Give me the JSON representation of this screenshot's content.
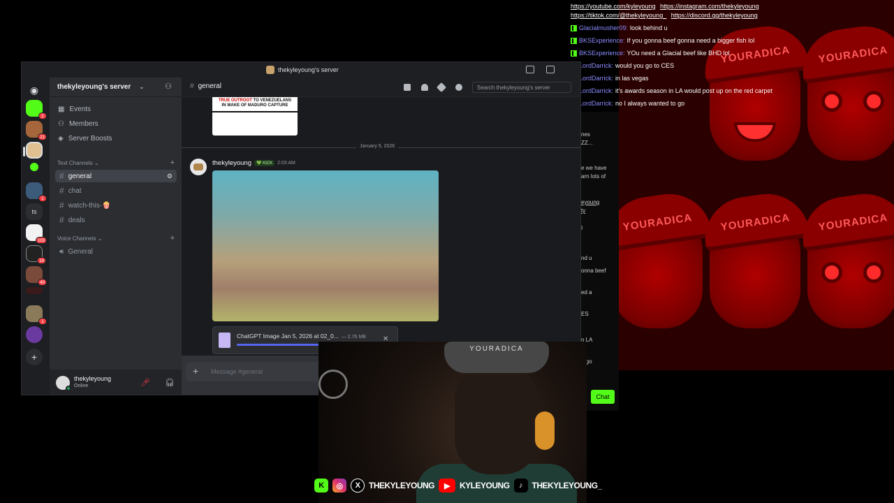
{
  "discord": {
    "window_title": "thekyleyoung's server",
    "server_name": "thekyleyoung's server",
    "nav": [
      "Events",
      "Members",
      "Server Boosts"
    ],
    "text_category": "Text Channels",
    "voice_category": "Voice Channels",
    "text_channels": [
      "general",
      "chat",
      "watch-this-🍿",
      "deals"
    ],
    "voice_channels": [
      "General"
    ],
    "server_badges": [
      "2",
      "21",
      "1",
      "103",
      "14",
      "40",
      "1"
    ],
    "server_ts_label": "ts",
    "user": {
      "name": "thekyleyoung",
      "status": "Online"
    },
    "channel_header": "general",
    "search_placeholder": "Search thekyleyoung's server",
    "embed_headline_red": "TRUE OUTROOT",
    "embed_headline_black": "TO VENEZUELANS IN WAKE OF MADURO CAPTURE",
    "date_divider": "January 5, 2026",
    "message": {
      "author": "thekyleyoung",
      "tag": "KICK",
      "time": "2:03 AM"
    },
    "attachment": {
      "name": "ChatGPT Image Jan 5, 2026 at 02_0...",
      "size": "— 2.76 MB"
    },
    "composer_placeholder": "Message #general"
  },
  "chat": {
    "links_line1": [
      "https://youtube.com/kyleyoung",
      "https://instagram.com/thekyleyoung"
    ],
    "links_line2": [
      "https://tiktok.com/@thekyleyoung_",
      "https://discord.gg/thekyleyoung"
    ],
    "messages": [
      {
        "user": "Glacialmusher09:",
        "text": "look behind u"
      },
      {
        "user": "BKSExperience:",
        "text": "If you gonna beef gonna need a bigger fish lol"
      },
      {
        "user": "BKSExperience:",
        "text": "YOu need a Glacial beef like BHD lol"
      },
      {
        "user": "LordDarrick:",
        "text": "would you go to CES"
      },
      {
        "user": "LordDarrick:",
        "text": "in las vegas"
      },
      {
        "user": "LordDarrick:",
        "text": "it's awards season in LA would post up on the red carpet"
      },
      {
        "user": "LordDarrick:",
        "text": "no I always wanted to go"
      }
    ]
  },
  "kick_panel": {
    "snippets": [
      "nes",
      "ZZ...",
      "e we have",
      "arn lots of",
      "eyoung",
      "ty",
      "I",
      "nd u",
      "onna beef",
      "ed a",
      "ES",
      "n LA",
      "o go"
    ],
    "chat_button": "Chat"
  },
  "overlay": {
    "cap_text": "YOURADICA",
    "webcam_cap_text": "YOURADICA",
    "x_handle": "THEKYLEYOUNG",
    "youtube_handle": "KYLEYOUNG",
    "tiktok_handle": "THEKYLEYOUNG_"
  },
  "colors": {
    "kick_green": "#53fc18",
    "discord_blurple": "#5865f2",
    "overlay_red": "#b00000"
  }
}
